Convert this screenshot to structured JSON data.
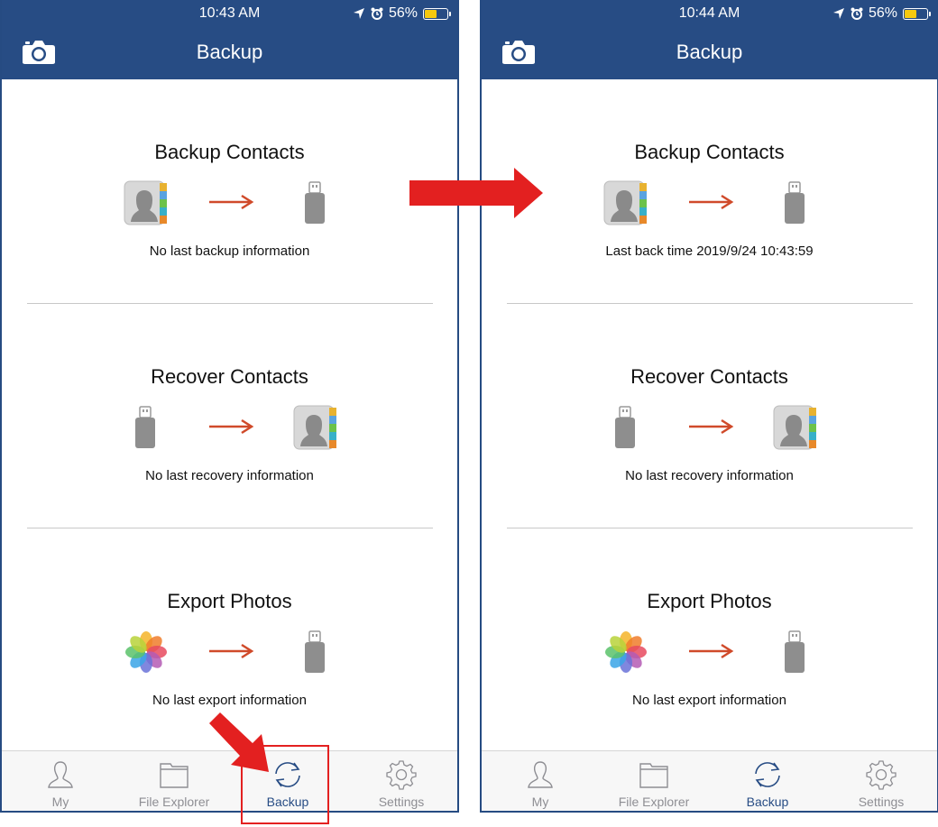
{
  "screens": [
    {
      "status": {
        "time": "10:43 AM",
        "battery": "56%"
      },
      "header": {
        "title": "Backup"
      },
      "sections": [
        {
          "title": "Backup Contacts",
          "info": "No last backup information"
        },
        {
          "title": "Recover Contacts",
          "info": "No last recovery information"
        },
        {
          "title": "Export Photos",
          "info": "No last export information"
        }
      ],
      "tabs": [
        {
          "label": "My",
          "icon": "person-icon"
        },
        {
          "label": "File Explorer",
          "icon": "folder-icon"
        },
        {
          "label": "Backup",
          "icon": "sync-icon",
          "active": true
        },
        {
          "label": "Settings",
          "icon": "gear-icon"
        }
      ]
    },
    {
      "status": {
        "time": "10:44 AM",
        "battery": "56%"
      },
      "header": {
        "title": "Backup"
      },
      "sections": [
        {
          "title": "Backup Contacts",
          "info": "Last back time 2019/9/24 10:43:59"
        },
        {
          "title": "Recover Contacts",
          "info": "No last recovery information"
        },
        {
          "title": "Export Photos",
          "info": "No last export information"
        }
      ],
      "tabs": [
        {
          "label": "My",
          "icon": "person-icon"
        },
        {
          "label": "File Explorer",
          "icon": "folder-icon"
        },
        {
          "label": "Backup",
          "icon": "sync-icon",
          "active": true
        },
        {
          "label": "Settings",
          "icon": "gear-icon"
        }
      ]
    }
  ],
  "colors": {
    "header": "#274c84",
    "active_tab": "#274c84",
    "inactive_tab": "#8e8e93",
    "flow_arrow": "#d04a2a",
    "annotation": "#e32020",
    "battery": "#f6c90e"
  }
}
